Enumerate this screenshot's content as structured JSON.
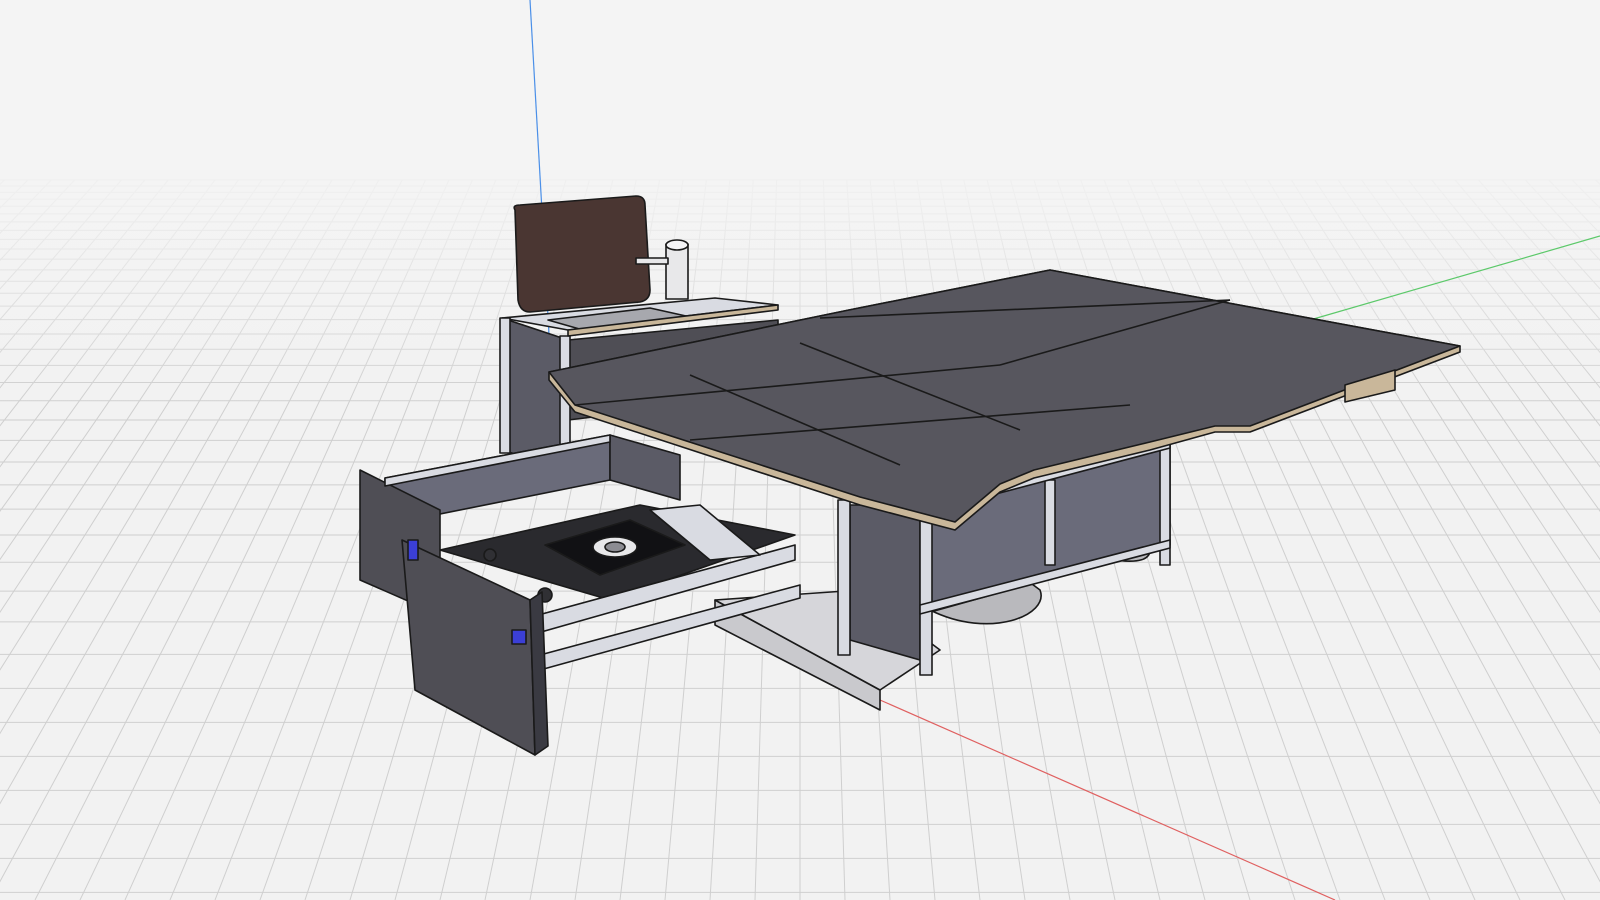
{
  "app": {
    "view": "3d-cad-viewport",
    "background": "#f2f2f2",
    "grid_color": "#cfcfcf",
    "axis_colors": {
      "x": "#e06060",
      "y": "#4a8fe8",
      "z": "#5cc96a"
    }
  },
  "model": {
    "name": "",
    "parts": [
      "sink-cabinet",
      "sink-lid",
      "faucet",
      "table-top",
      "table-frame",
      "drawer",
      "stove",
      "drawer-slides",
      "drawer-front",
      "latch",
      "base-feet"
    ],
    "colors": {
      "panel_dark": "#4f4e55",
      "panel_mid": "#5b5b66",
      "panel_light": "#6a6b7a",
      "aluminium": "#d9dbe2",
      "edge": "#1a1a1a",
      "plywood_edge": "#c9b79a",
      "lid_brown": "#4a3632",
      "latch_blue": "#3b3fd6",
      "foot_grey": "#b9b9bd"
    }
  }
}
